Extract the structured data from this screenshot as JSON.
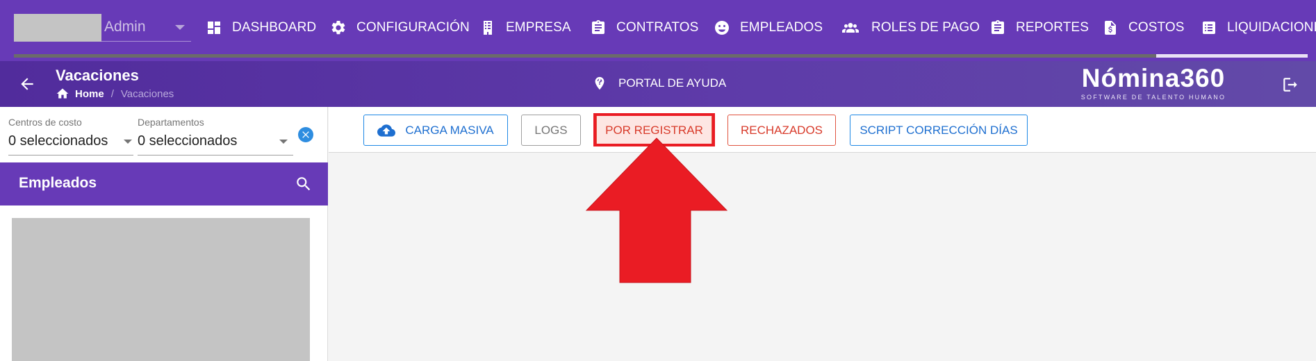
{
  "topnav": {
    "user_name": "Admin",
    "items": [
      {
        "label": "DASHBOARD",
        "icon": "dashboard-icon"
      },
      {
        "label": "CONFIGURACIÓN",
        "icon": "gear-icon"
      },
      {
        "label": "EMPRESA",
        "icon": "building-icon"
      },
      {
        "label": "CONTRATOS",
        "icon": "clipboard-icon"
      },
      {
        "label": "EMPLEADOS",
        "icon": "face-icon"
      },
      {
        "label": "ROLES DE PAGO",
        "icon": "people-icon"
      },
      {
        "label": "REPORTES",
        "icon": "clipboard-icon"
      },
      {
        "label": "COSTOS",
        "icon": "invoice-dollar-icon"
      },
      {
        "label": "LIQUIDACIONE",
        "icon": "list-icon"
      }
    ]
  },
  "subheader": {
    "title": "Vacaciones",
    "breadcrumb": {
      "home": "Home",
      "separator": "/",
      "current": "Vacaciones"
    },
    "help_label": "PORTAL DE AYUDA",
    "brand_name": "Nómina360",
    "brand_tagline": "SOFTWARE DE TALENTO HUMANO"
  },
  "filters": {
    "cost_centers": {
      "label": "Centros de costo",
      "value": "0 seleccionados"
    },
    "departments": {
      "label": "Departamentos",
      "value": "0 seleccionados"
    }
  },
  "employees_panel": {
    "title": "Empleados"
  },
  "toolbar": {
    "bulk_upload_label": "CARGA MASIVA",
    "logs_label": "LOGS",
    "pending_label": "POR REGISTRAR",
    "rejected_label": "RECHAZADOS",
    "script_label": "SCRIPT CORRECCIÓN DÍAS"
  },
  "colors": {
    "primary": "#673ab7",
    "accent_blue": "#1e88e5",
    "danger": "#d83a2a",
    "annotation_red": "#ea1c24"
  }
}
